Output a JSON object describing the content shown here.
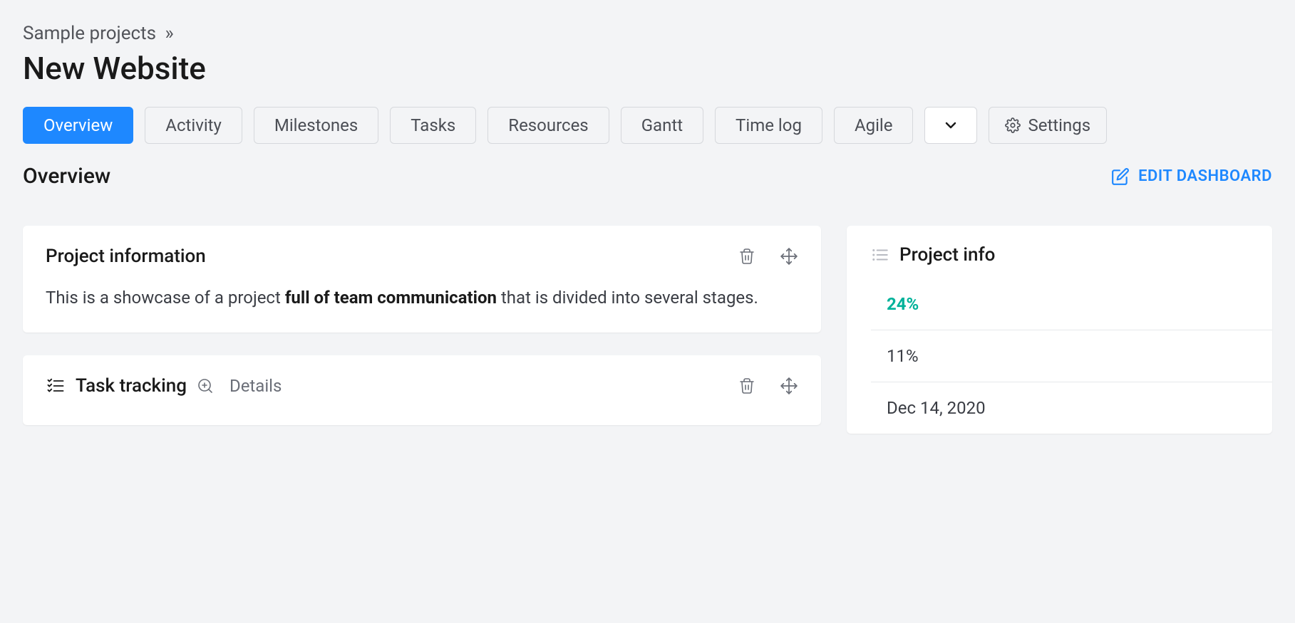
{
  "breadcrumb": {
    "parent": "Sample projects",
    "separator": "»"
  },
  "page_title": "New Website",
  "tabs": {
    "overview": "Overview",
    "activity": "Activity",
    "milestones": "Milestones",
    "tasks": "Tasks",
    "resources": "Resources",
    "gantt": "Gantt",
    "time_log": "Time log",
    "agile": "Agile",
    "settings": "Settings"
  },
  "section": {
    "title": "Overview",
    "edit_label": "EDIT DASHBOARD"
  },
  "project_information": {
    "title": "Project information",
    "desc_prefix": "This is a showcase of a project ",
    "desc_bold": "full of team communication",
    "desc_suffix": " that is divided into several stages."
  },
  "task_tracking": {
    "title": "Task tracking",
    "details_label": "Details"
  },
  "project_info_panel": {
    "title": "Project info",
    "rows": {
      "row0": "24%",
      "row1": "11%",
      "row2": "Dec 14, 2020"
    }
  }
}
